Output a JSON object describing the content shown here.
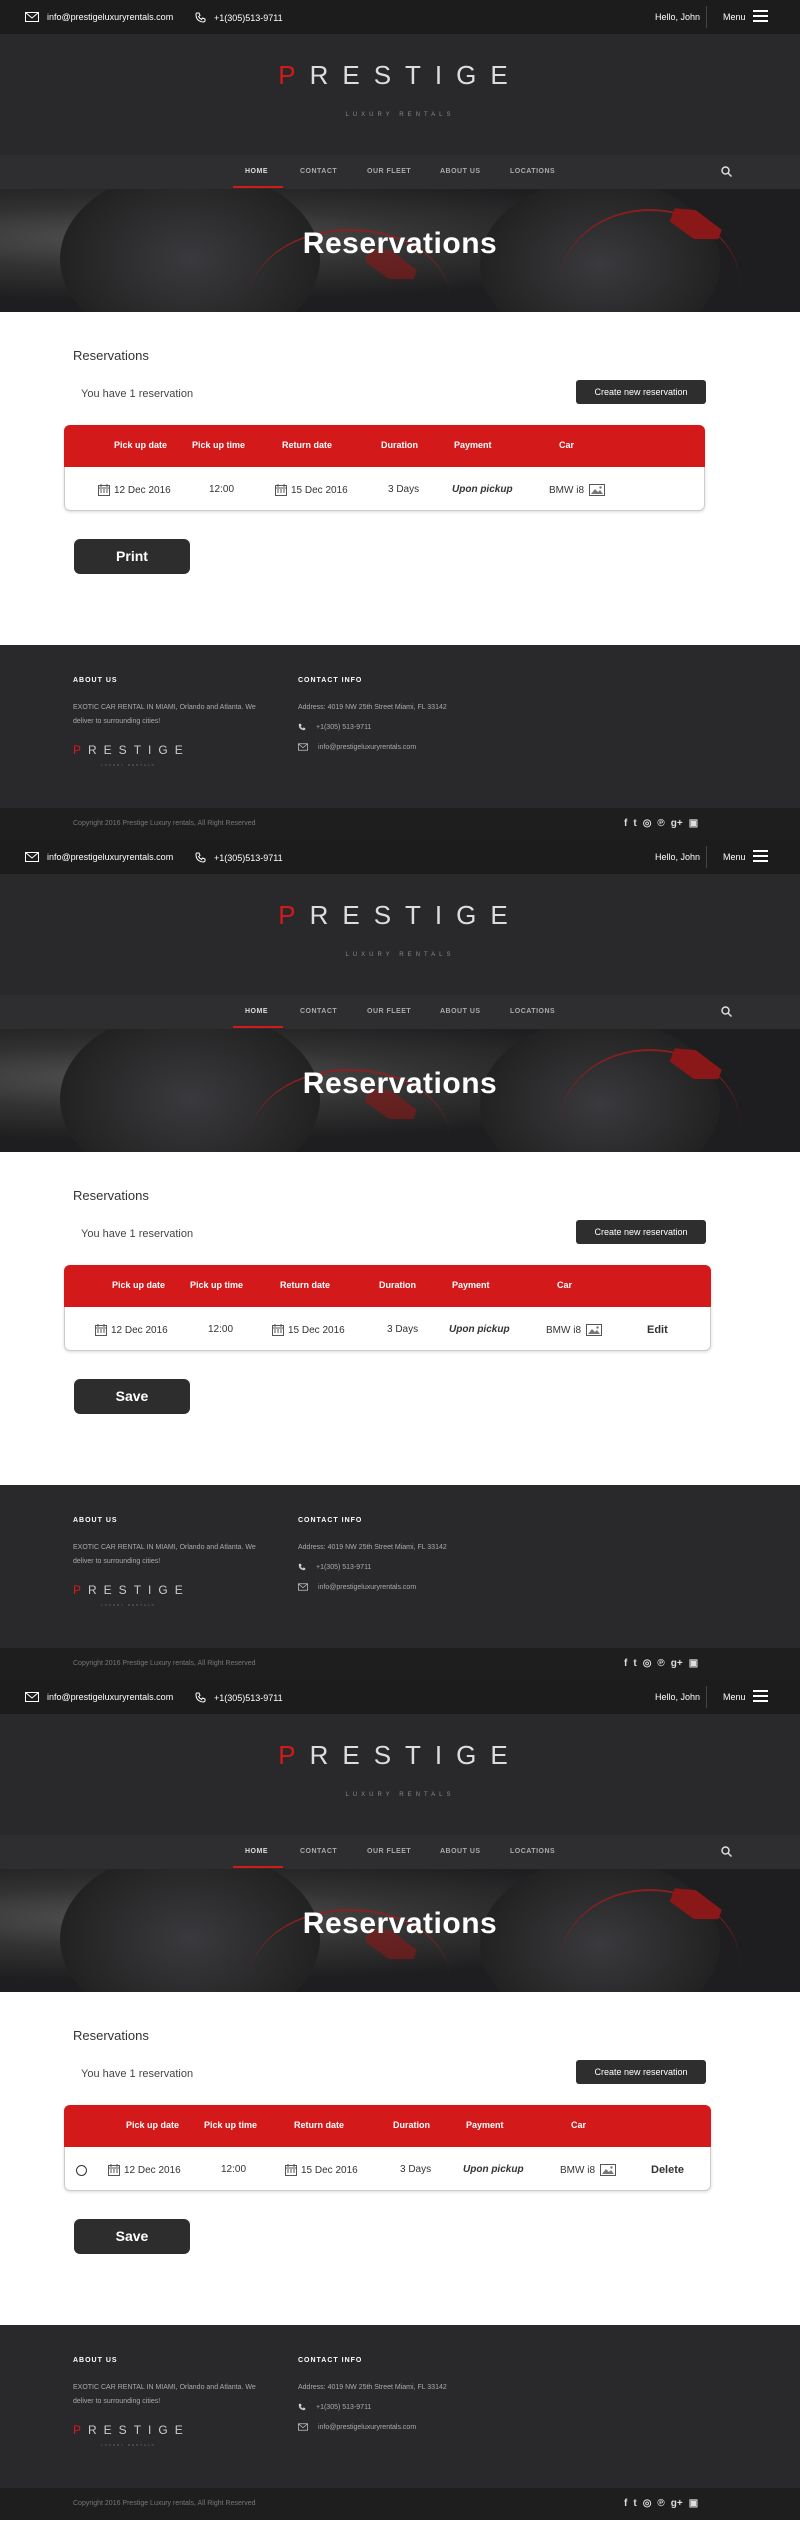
{
  "topbar": {
    "email": "info@prestigeluxuryrentals.com",
    "phone": "+1(305)513-9711",
    "greeting": "Hello, John",
    "menu_label": "Menu"
  },
  "brand": {
    "logo_first": "P",
    "logo_rest": "RESTIGE",
    "tagline": "LUXURY RENTALS",
    "accent_color": "#d3191a"
  },
  "nav": {
    "items": [
      "HOME",
      "CONTACT",
      "OUR FLEET",
      "ABOUT US",
      "LOCATIONS"
    ],
    "active": "HOME"
  },
  "hero": {
    "title": "Reservations"
  },
  "reservations": {
    "section_title": "Reservations",
    "count_text": "You have 1 reservation",
    "create_button": "Create new reservation",
    "columns": [
      "Pick up date",
      "Pick up time",
      "Return date",
      "Duration",
      "Payment",
      "Car"
    ],
    "row": {
      "pickup_date": "12 Dec 2016",
      "pickup_time": "12:00",
      "return_date": "15 Dec 2016",
      "duration": "3 Days",
      "payment": "Upon pickup",
      "car": "BMW i8"
    }
  },
  "screens": [
    {
      "action_button": "Print",
      "row_action": ""
    },
    {
      "action_button": "Save",
      "row_action": "Edit"
    },
    {
      "action_button": "Save",
      "row_action": "Delete"
    }
  ],
  "footer": {
    "about_heading": "ABOUT US",
    "about_text_1": "EXOTIC CAR RENTAL IN MIAMI, Orlando and Atlanta. We",
    "about_text_2": "deliver to surrounding cities!",
    "contact_heading": "CONTACT INFO",
    "address": "Address: 4019 NW 25th Street Miami, FL 33142",
    "phone": "+1(305) 513-9711",
    "email": "info@prestigeluxuryrentals.com",
    "copyright": "Copyright 2016 Prestige Luxury rentals, All Right Reserved",
    "social": [
      "facebook-icon",
      "twitter-icon",
      "dribbble-icon",
      "pinterest-icon",
      "google-plus-icon",
      "instagram-icon"
    ]
  }
}
